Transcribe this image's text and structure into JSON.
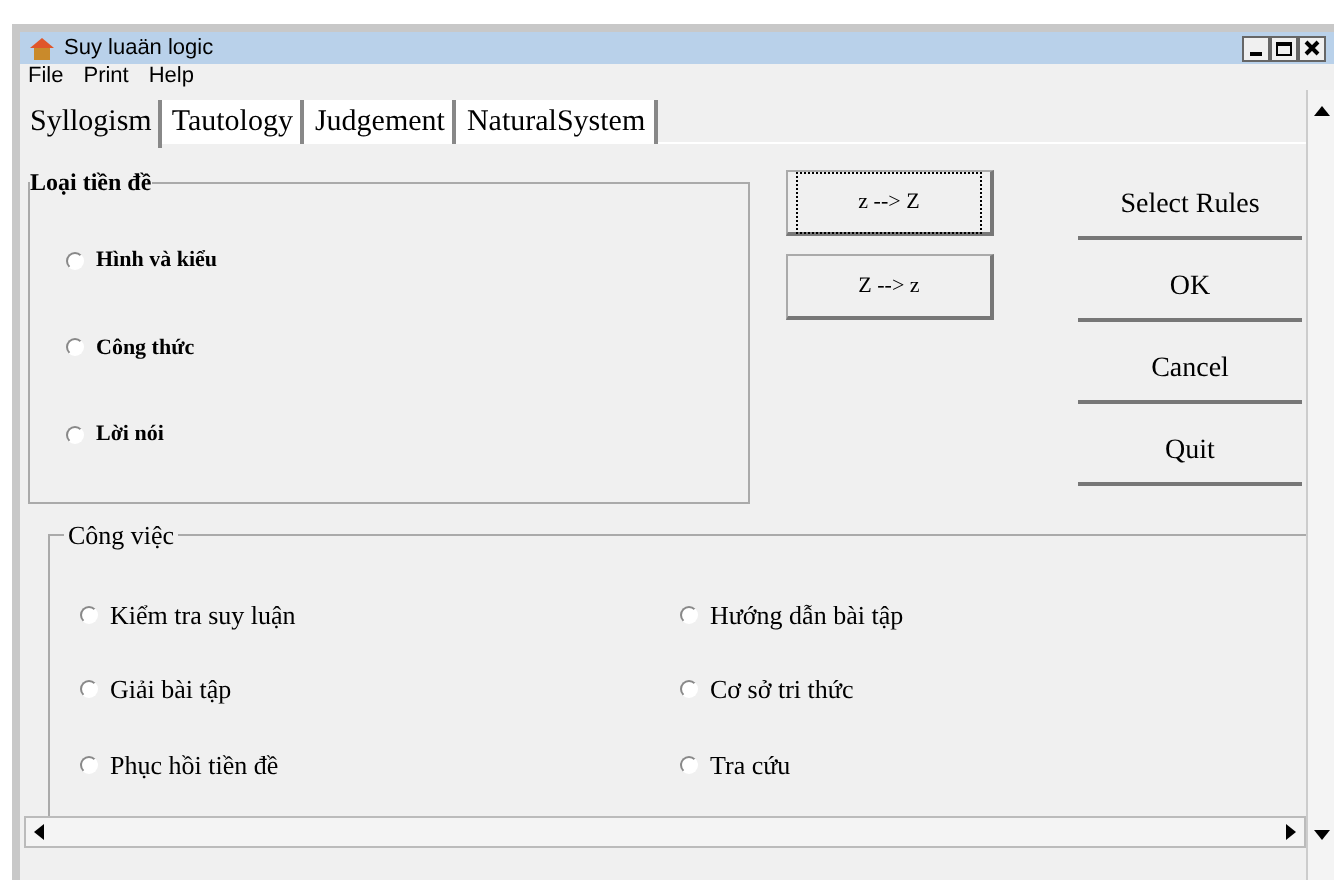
{
  "window": {
    "title": "Suy luaän logic"
  },
  "menu": [
    "File",
    "Print",
    "Help"
  ],
  "tabs": [
    {
      "label": "Syllogism",
      "selected": true
    },
    {
      "label": "Tautology",
      "selected": false
    },
    {
      "label": "Judgement",
      "selected": false
    },
    {
      "label": "NaturalSystem",
      "selected": false
    }
  ],
  "premise_group": {
    "title": "Loại tiền đề",
    "options": [
      {
        "label": "Hình và kiểu",
        "selected": false
      },
      {
        "label": "Công thức",
        "selected": false
      },
      {
        "label": "Lời nói",
        "selected": false
      }
    ]
  },
  "convert_buttons": [
    {
      "label": "z --> Z",
      "focused": true
    },
    {
      "label": "Z --> z",
      "focused": false
    }
  ],
  "action_buttons": [
    "Select Rules",
    "OK",
    "Cancel",
    "Quit"
  ],
  "task_group": {
    "title": "Công việc",
    "options": [
      {
        "label": "Kiểm tra suy luận",
        "selected": false
      },
      {
        "label": "Hướng dẫn bài tập",
        "selected": false
      },
      {
        "label": "Giải bài tập",
        "selected": false
      },
      {
        "label": "Cơ sở tri thức",
        "selected": false
      },
      {
        "label": "Phục hồi tiền đề",
        "selected": false
      },
      {
        "label": "Tra cứu",
        "selected": false
      }
    ]
  }
}
